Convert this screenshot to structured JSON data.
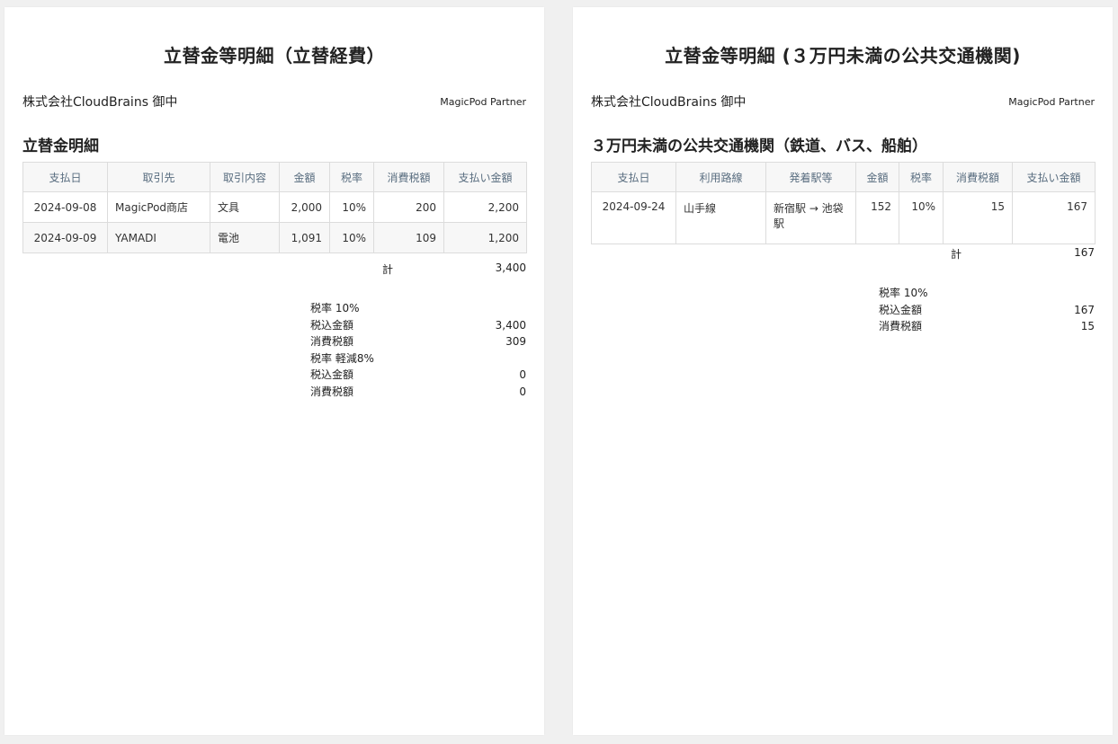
{
  "left": {
    "title": "立替金等明細（立替経費）",
    "recipient": "株式会社CloudBrains 御中",
    "issuer": "MagicPod Partner",
    "section_title": "立替金明細",
    "columns": [
      "支払日",
      "取引先",
      "取引内容",
      "金額",
      "税率",
      "消費税額",
      "支払い金額"
    ],
    "rows": [
      [
        "2024-09-08",
        "MagicPod商店",
        "文具",
        "2,000",
        "10%",
        "200",
        "2,200"
      ],
      [
        "2024-09-09",
        "YAMADI",
        "電池",
        "1,091",
        "10%",
        "109",
        "1,200"
      ]
    ],
    "total_label": "計",
    "total_value": "3,400",
    "tax_summary": [
      {
        "label": "税率 10%",
        "value": ""
      },
      {
        "label": "税込金額",
        "value": "3,400"
      },
      {
        "label": "消費税額",
        "value": "309"
      },
      {
        "label": "税率 軽減8%",
        "value": ""
      },
      {
        "label": "税込金額",
        "value": "0"
      },
      {
        "label": "消費税額",
        "value": "0"
      }
    ]
  },
  "right": {
    "title": "立替金等明細 (３万円未満の公共交通機関)",
    "recipient": "株式会社CloudBrains 御中",
    "issuer": "MagicPod Partner",
    "section_title": "３万円未満の公共交通機関（鉄道、バス、船舶）",
    "columns": [
      "支払日",
      "利用路線",
      "発着駅等",
      "金額",
      "税率",
      "消費税額",
      "支払い金額"
    ],
    "rows": [
      [
        "2024-09-24",
        "山手線",
        "新宿駅 → 池袋駅",
        "152",
        "10%",
        "15",
        "167"
      ]
    ],
    "total_label": "計",
    "total_value": "167",
    "tax_summary": [
      {
        "label": "税率 10%",
        "value": ""
      },
      {
        "label": "税込金額",
        "value": "167"
      },
      {
        "label": "消費税額",
        "value": "15"
      }
    ]
  }
}
